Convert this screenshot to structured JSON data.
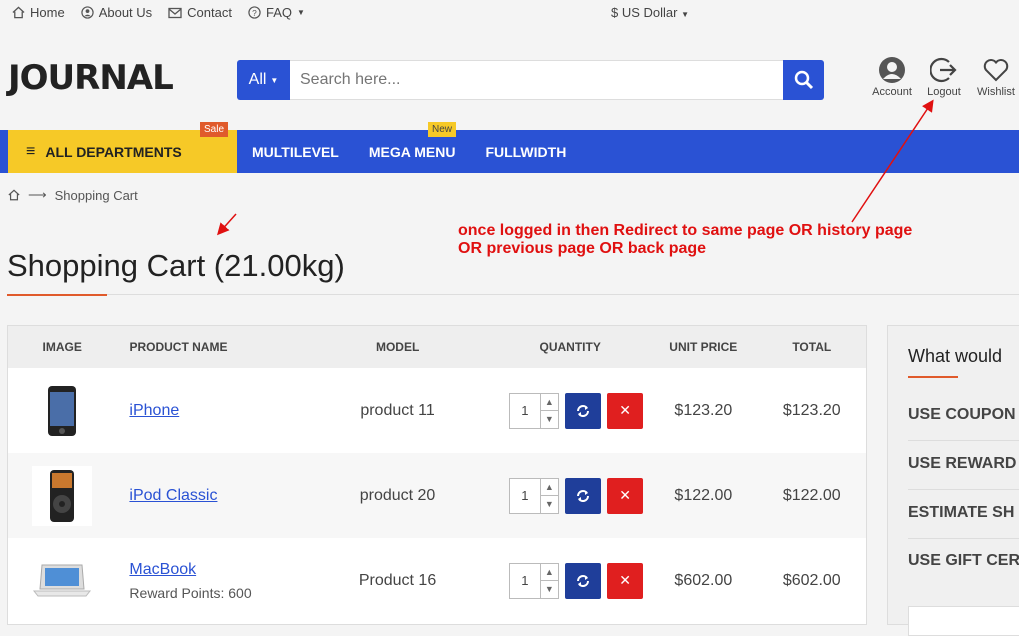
{
  "topbar": {
    "home": "Home",
    "about": "About Us",
    "contact": "Contact",
    "faq": "FAQ",
    "currency": "$ US Dollar"
  },
  "header": {
    "logo": "JOURNAL",
    "search_category": "All",
    "search_placeholder": "Search here...",
    "account": "Account",
    "logout": "Logout",
    "wishlist": "Wishlist"
  },
  "nav": {
    "departments": "ALL DEPARTMENTS",
    "sale_badge": "Sale",
    "multilevel": "MULTILEVEL",
    "mega_menu": "MEGA MENU",
    "new_badge": "New",
    "fullwidth": "FULLWIDTH"
  },
  "breadcrumb": {
    "current": "Shopping Cart"
  },
  "page": {
    "title": "Shopping Cart  (21.00kg)"
  },
  "annotation": "once logged in then Redirect to same page OR history page OR previous page OR back page",
  "cart": {
    "headers": {
      "image": "IMAGE",
      "name": "PRODUCT NAME",
      "model": "MODEL",
      "quantity": "QUANTITY",
      "unit": "UNIT PRICE",
      "total": "TOTAL"
    },
    "rows": [
      {
        "name": "iPhone",
        "model": "product 11",
        "qty": "1",
        "unit": "$123.20",
        "total": "$123.20",
        "reward": ""
      },
      {
        "name": "iPod Classic",
        "model": "product 20",
        "qty": "1",
        "unit": "$122.00",
        "total": "$122.00",
        "reward": ""
      },
      {
        "name": "MacBook",
        "model": "Product 16",
        "qty": "1",
        "unit": "$602.00",
        "total": "$602.00",
        "reward": "Reward Points: 600"
      }
    ]
  },
  "sidebar": {
    "title": "What would",
    "items": [
      "USE COUPON",
      "USE REWARD",
      "ESTIMATE SH",
      "USE GIFT CER"
    ]
  },
  "colors": {
    "brand_blue": "#2a52d4",
    "yellow": "#f6c927",
    "danger": "#e01f1f",
    "accent": "#e05a2b",
    "annotation": "#e01010"
  }
}
